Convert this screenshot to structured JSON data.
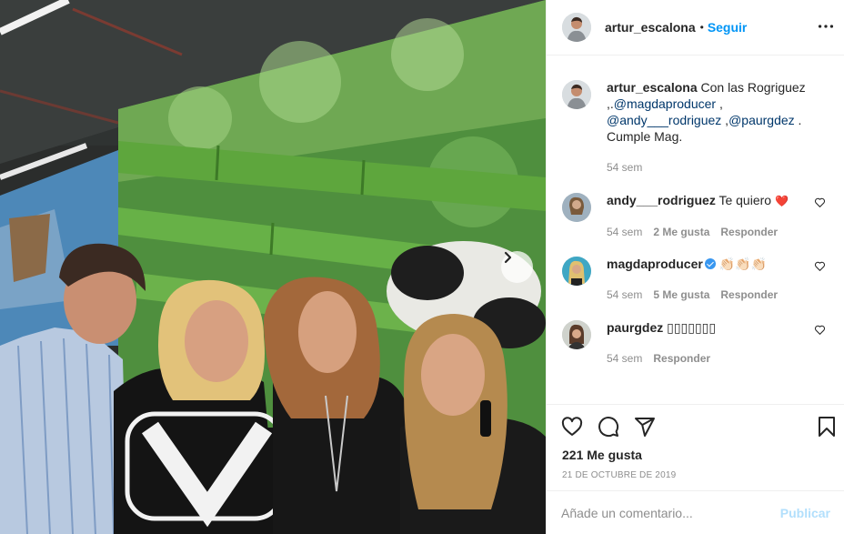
{
  "post": {
    "photo_alt": "",
    "next_icon": "chevron-right-icon"
  },
  "header": {
    "username": "artur_escalona",
    "separator": "•",
    "follow_label": "Seguir",
    "more_icon": "more-horizontal-icon"
  },
  "caption": {
    "username": "artur_escalona",
    "text_before": "Con las Rogriguez ,.",
    "mention1": "@magdaproducer",
    "text_mid1": " ,",
    "mention2": "@andy___rodriguez",
    "text_mid2": " ,",
    "mention3": "@paurgdez",
    "text_after": " . Cumple Mag.",
    "time": "54 sem"
  },
  "comments": [
    {
      "username": "andy___rodriguez",
      "text": "Te quiero",
      "emoji": "❤️",
      "time": "54 sem",
      "likes": "2 Me gusta",
      "reply": "Responder"
    },
    {
      "username": "magdaproducer",
      "text": "👏🏻👏🏻👏🏻",
      "time": "54 sem",
      "likes": "5 Me gusta",
      "reply": "Responder",
      "verified": true
    },
    {
      "username": "paurgdez",
      "text": "▯▯▯▯▯▯▯",
      "time": "54 sem",
      "reply": "Responder"
    }
  ],
  "actions": {
    "like_icon": "heart-icon",
    "comment_icon": "comment-icon",
    "share_icon": "share-icon",
    "save_icon": "bookmark-icon",
    "likes_count": "221 Me gusta",
    "date": "21 DE OCTUBRE DE 2019"
  },
  "add_comment": {
    "placeholder": "Añade un comentario...",
    "publish_label": "Publicar"
  },
  "colors": {
    "link": "#0095f6",
    "mention": "#00376b",
    "muted": "#8e8e8e",
    "publish_disabled": "#b2dffc"
  }
}
